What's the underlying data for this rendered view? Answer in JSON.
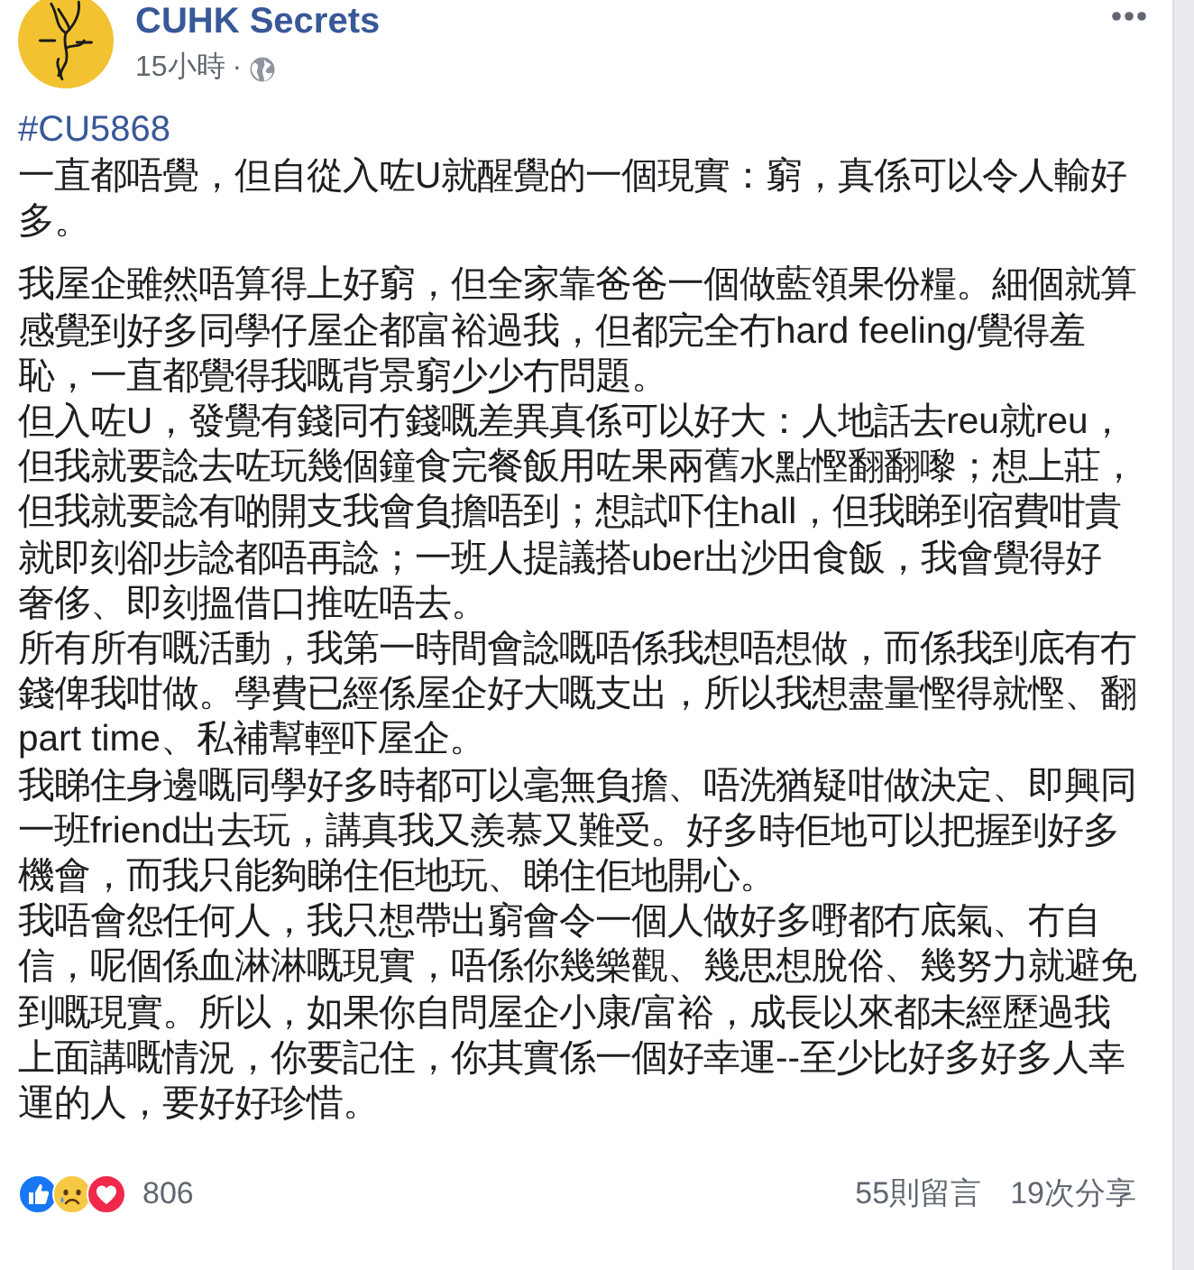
{
  "post": {
    "author": "CUHK Secrets",
    "time": "15小時",
    "separator": "·",
    "hashtag": "#CU5868",
    "paragraphs": [
      [
        "一直都唔覺，但自從入咗U就醒覺的一個現實：窮，真係可以令人輸好多。"
      ],
      [
        "我屋企雖然唔算得上好窮，但全家靠爸爸一個做藍領果份糧。細個就算感覺到好多同學仔屋企都富裕過我，但都完全冇hard feeling/覺得羞恥，一直都覺得我嘅背景窮少少冇問題。",
        "但入咗U，發覺有錢同冇錢嘅差異真係可以好大：人地話去reu就reu，但我就要諗去咗玩幾個鐘食完餐飯用咗果兩舊水點慳翻翻嚟；想上莊，但我就要諗有啲開支我會負擔唔到；想試吓住hall，但我睇到宿費咁貴就即刻卻步諗都唔再諗；一班人提議搭uber出沙田食飯，我會覺得好奢侈、即刻搵借口推咗唔去。",
        "所有所有嘅活動，我第一時間會諗嘅唔係我想唔想做，而係我到底有冇錢俾我咁做。學費已經係屋企好大嘅支出，所以我想盡量慳得就慳、翻part time、私補幫輕吓屋企。",
        "我睇住身邊嘅同學好多時都可以毫無負擔、唔洗猶疑咁做決定、即興同一班friend出去玩，講真我又羨慕又難受。好多時佢地可以把握到好多機會，而我只能夠睇住佢地玩、睇住佢地開心。",
        "我唔會怨任何人，我只想帶出窮會令一個人做好多嘢都冇底氣、冇自信，呢個係血淋淋嘅現實，唔係你幾樂觀、幾思想脫俗、幾努力就避免到嘅現實。所以，如果你自問屋企小康/富裕，成長以來都未經歷過我上面講嘅情況，你要記住，你其實係一個好幸運--至少比好多好多人幸運的人，要好好珍惜。"
      ]
    ]
  },
  "footer": {
    "reaction_count": "806",
    "comments": "55則留言",
    "shares": "19次分享"
  }
}
